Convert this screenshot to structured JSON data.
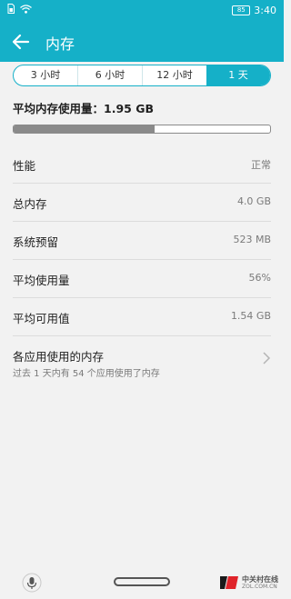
{
  "status_bar": {
    "time": "3:40",
    "battery_level": "85"
  },
  "header": {
    "title": "内存"
  },
  "time_range": {
    "options": [
      "3 小时",
      "6 小时",
      "12 小时",
      "1 天"
    ],
    "selected_index": 3
  },
  "summary": {
    "label": "平均内存使用量：1.95 GB",
    "usage_fraction": 0.55
  },
  "rows": [
    {
      "label": "性能",
      "value": "正常"
    },
    {
      "label": "总内存",
      "value": "4.0 GB"
    },
    {
      "label": "系统预留",
      "value": "523 MB"
    },
    {
      "label": "平均使用量",
      "value": "56%"
    },
    {
      "label": "平均可用值",
      "value": "1.54 GB"
    }
  ],
  "app_usage": {
    "title": "各应用使用的内存",
    "subtitle": "过去 1 天内有 54 个应用使用了内存"
  },
  "watermark": {
    "name": "中关村在线",
    "url": "ZOL.COM.CN"
  },
  "colors": {
    "accent": "#15b0c8",
    "bar_fill": "#8a8a8a"
  }
}
